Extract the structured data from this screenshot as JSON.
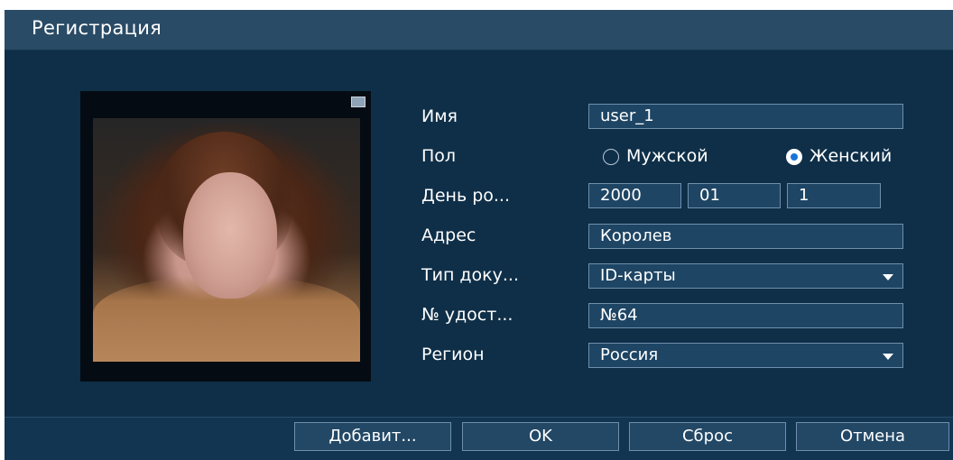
{
  "window": {
    "title": "Регистрация"
  },
  "form": {
    "name": {
      "label": "Имя",
      "value": "user_1"
    },
    "gender": {
      "label": "Пол",
      "options": [
        "Мужской",
        "Женский"
      ],
      "selected": "Женский"
    },
    "birthday": {
      "label": "День ро...",
      "year": "2000",
      "month": "01",
      "day": "1"
    },
    "address": {
      "label": "Адрес",
      "value": "Королев"
    },
    "doc_type": {
      "label": "Тип доку...",
      "value": "ID-карты"
    },
    "doc_number": {
      "label": "№ удост...",
      "value": "№64"
    },
    "region": {
      "label": "Регион",
      "value": "Россия"
    }
  },
  "buttons": {
    "add": "Добавит...",
    "ok": "OK",
    "reset": "Сброс",
    "cancel": "Отмена"
  },
  "icons": {
    "dropdown": "chevron-down-icon",
    "photo_close": "close-icon"
  },
  "colors": {
    "dialog_bg": "#0f2f48",
    "titlebar_bg": "#2a4b66",
    "field_bg": "#1e4564",
    "field_border": "#6f8fac",
    "radio_selected": "#1a73d9"
  }
}
